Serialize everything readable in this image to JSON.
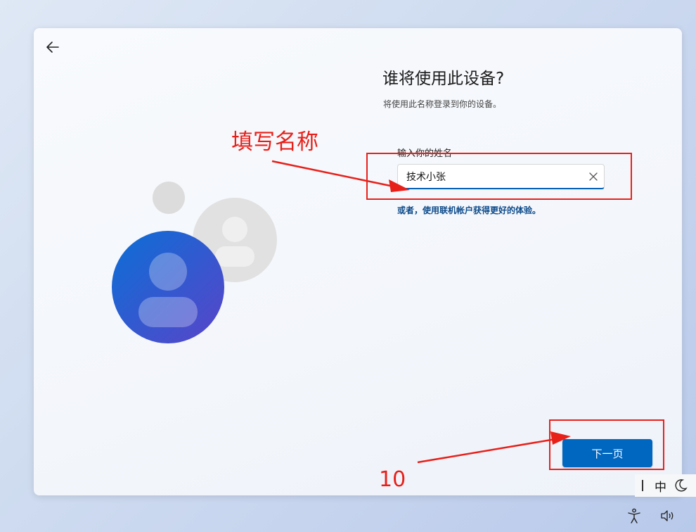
{
  "page": {
    "title": "谁将使用此设备?",
    "subtitle": "将使用此名称登录到你的设备。",
    "name_label": "输入你的姓名",
    "name_value": "技术小张",
    "ms_account_link": "或者，使用联机帐户获得更好的体验。",
    "next_button": "下一页"
  },
  "annotations": {
    "fill_name": "填写名称",
    "step_number": "10"
  },
  "ime": {
    "language": "中"
  },
  "icons": {
    "back": "back-arrow-icon",
    "clear": "clear-icon",
    "moon": "moon-icon",
    "accessibility": "accessibility-icon",
    "volume": "volume-icon"
  },
  "colors": {
    "accent": "#0067c0",
    "annotation": "#e8201a",
    "link": "#0b4a8a"
  }
}
